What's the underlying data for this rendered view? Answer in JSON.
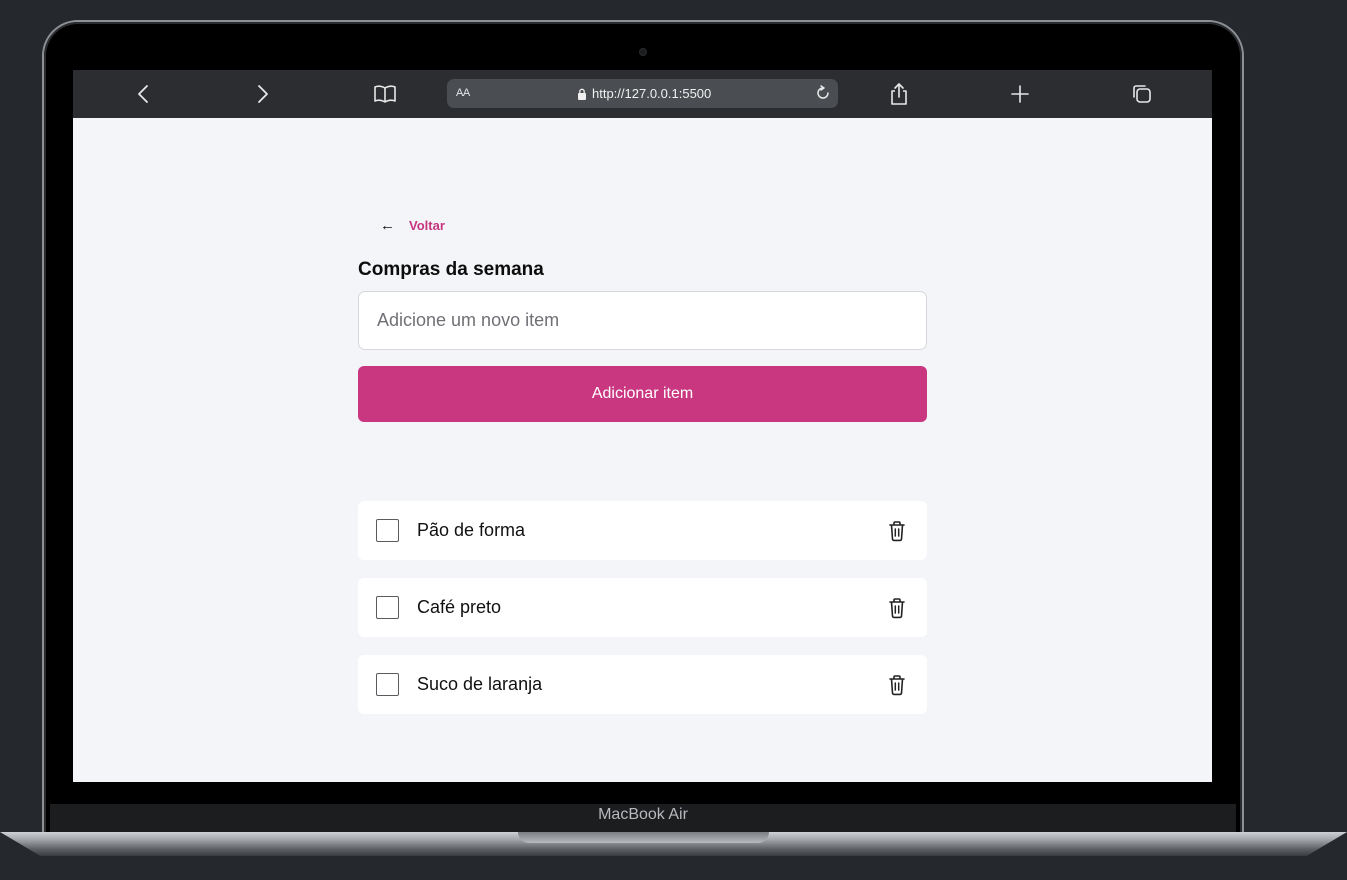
{
  "browser": {
    "text_size_label": "AA",
    "url": "http://127.0.0.1:5500"
  },
  "page": {
    "back_label": "Voltar",
    "title": "Compras da semana",
    "input_placeholder": "Adicione um novo item",
    "add_button_label": "Adicionar item",
    "items": [
      {
        "label": "Pão de forma",
        "checked": false
      },
      {
        "label": "Café preto",
        "checked": false
      },
      {
        "label": "Suco de laranja",
        "checked": false
      }
    ]
  },
  "device": {
    "model_label": "MacBook Air"
  },
  "colors": {
    "accent": "#ca3781",
    "page_background": "#f4f5f9",
    "toolbar_background": "#2b2d30"
  }
}
